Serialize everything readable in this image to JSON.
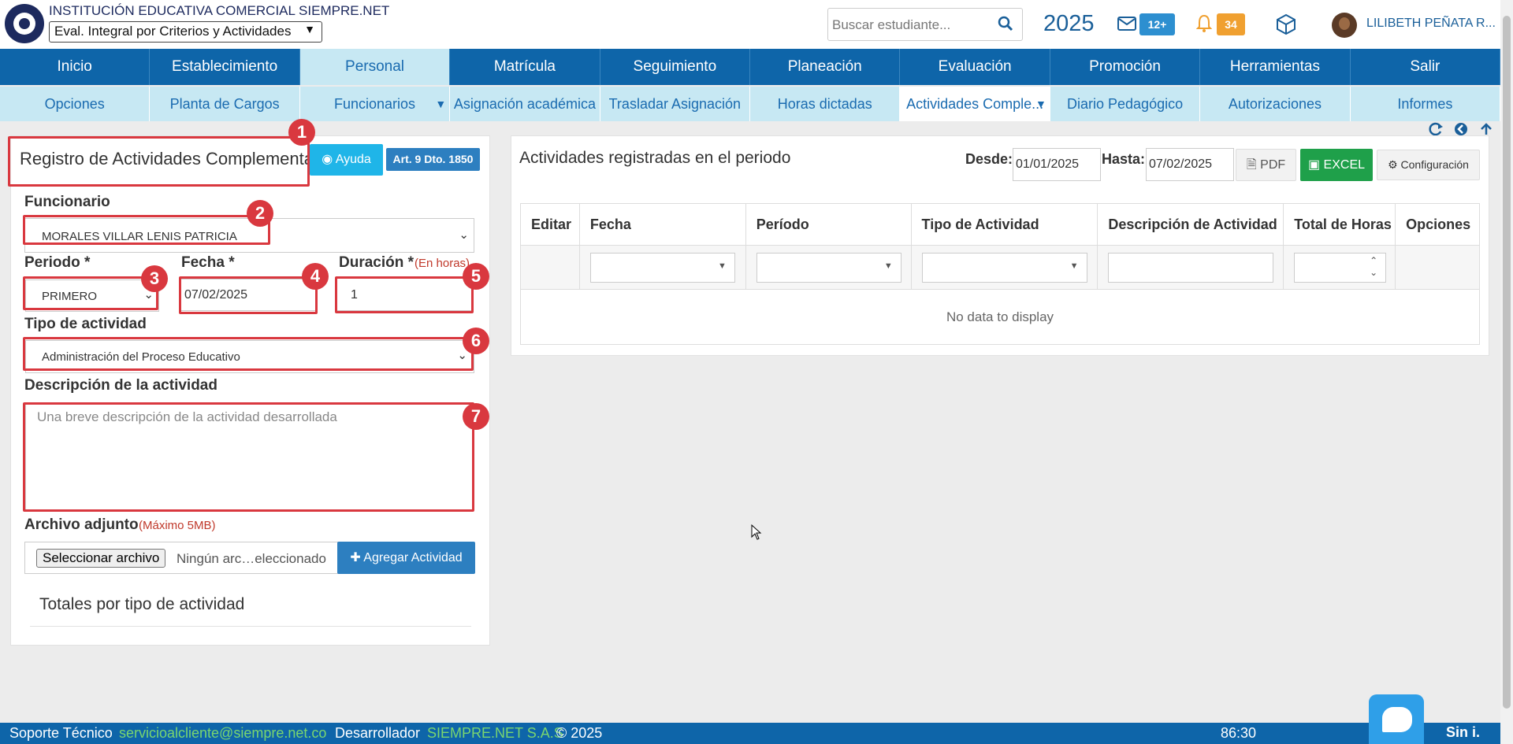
{
  "header": {
    "institution": "INSTITUCIÓN EDUCATIVA COMERCIAL SIEMPRE.NET",
    "eval_mode": "Eval. Integral por Criterios y Actividades",
    "search_placeholder": "Buscar estudiante...",
    "year": "2025",
    "messages_badge": "12+",
    "notifications_badge": "34",
    "user_name": "LILIBETH PEÑATA R..."
  },
  "menu_main": [
    "Inicio",
    "Establecimiento",
    "Personal",
    "Matrícula",
    "Seguimiento",
    "Planeación",
    "Evaluación",
    "Promoción",
    "Herramientas",
    "Salir"
  ],
  "menu_sub": [
    "Opciones",
    "Planta de Cargos",
    "Funcionarios",
    "Asignación académica",
    "Trasladar Asignación",
    "Horas dictadas",
    "Actividades Comple...",
    "Diario Pedagógico",
    "Autorizaciones",
    "Informes"
  ],
  "form": {
    "title": "Registro de Actividades Complementar",
    "help_label": "Ayuda",
    "article_label": "Art. 9 Dto. 1850",
    "funcionario_label": "Funcionario",
    "funcionario_value": "MORALES VILLAR LENIS PATRICIA",
    "periodo_label": "Periodo *",
    "periodo_value": "PRIMERO",
    "fecha_label": "Fecha *",
    "fecha_value": "07/02/2025",
    "duracion_label": "Duración *",
    "duracion_hint": "(En horas)",
    "duracion_value": "1",
    "tipo_label": "Tipo de actividad",
    "tipo_value": "Administración del Proceso Educativo",
    "descripcion_label": "Descripción de la actividad",
    "descripcion_placeholder": "Una breve descripción de la actividad desarrollada",
    "archivo_label": "Archivo adjunto",
    "archivo_hint": "(Máximo 5MB)",
    "file_button": "Seleccionar archivo",
    "file_status": "Ningún arc…eleccionado",
    "add_button": "Agregar Actividad",
    "totales_title": "Totales por tipo de actividad"
  },
  "annotations": [
    "1",
    "2",
    "3",
    "4",
    "5",
    "6",
    "7"
  ],
  "list": {
    "title": "Actividades registradas en el periodo",
    "desde_label": "Desde:",
    "desde_value": "01/01/2025",
    "hasta_label": "Hasta:",
    "hasta_value": "07/02/2025",
    "pdf_label": "PDF",
    "excel_label": "EXCEL",
    "config_label": "Configuración",
    "columns": [
      "Editar",
      "Fecha",
      "Período",
      "Tipo de Actividad",
      "Descripción de Actividad",
      "Total de Horas",
      "Opciones"
    ],
    "empty_text": "No data to display"
  },
  "footer": {
    "support_label": "Soporte Técnico",
    "support_email": "servicioalcliente@siempre.net.co",
    "dev_label": "Desarrollador",
    "dev_name": "SIEMPRE.NET S.A.S",
    "copyright": "© 2025",
    "timer": "86:30",
    "brand": "Sin i."
  },
  "colors": {
    "primary": "#0e65a9",
    "submenu": "#c7e8f3",
    "annotation": "#d9383f",
    "excel": "#1fa04a",
    "help": "#1fb5e8"
  }
}
